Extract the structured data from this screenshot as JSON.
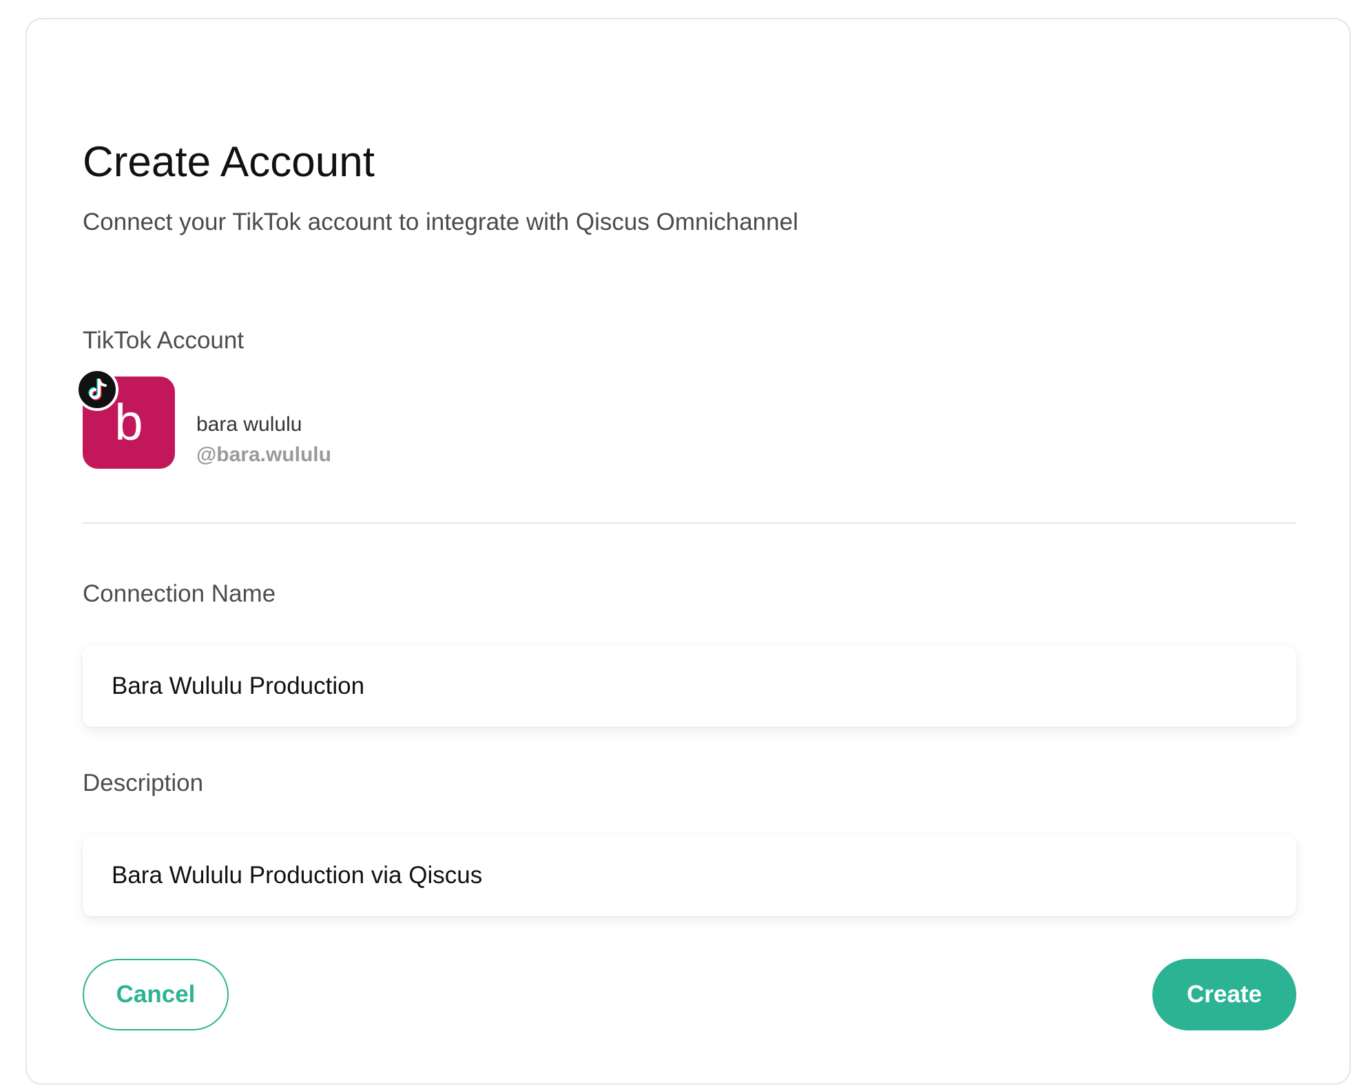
{
  "header": {
    "title": "Create Account",
    "subtitle": "Connect your TikTok account to integrate with Qiscus Omnichannel"
  },
  "account": {
    "section_label": "TikTok Account",
    "avatar_letter": "b",
    "avatar_color": "#c2185b",
    "badge_icon": "tiktok-icon",
    "name": "bara wululu",
    "handle": "@bara.wululu"
  },
  "form": {
    "connection_name": {
      "label": "Connection Name",
      "value": "Bara Wululu Production"
    },
    "description": {
      "label": "Description",
      "value": "Bara Wululu Production via Qiscus"
    }
  },
  "actions": {
    "cancel_label": "Cancel",
    "create_label": "Create"
  },
  "colors": {
    "accent": "#2bb394",
    "avatar": "#c2185b",
    "divider": "#e6e6e6"
  }
}
